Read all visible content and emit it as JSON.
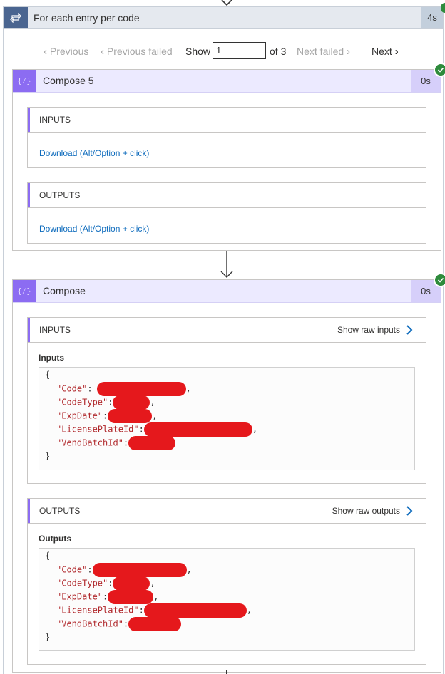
{
  "loop": {
    "title": "For each entry per code",
    "duration": "4s"
  },
  "pager": {
    "previous": "Previous",
    "previous_failed": "Previous failed",
    "show": "Show",
    "current": "1",
    "of_total": "of 3",
    "next_failed": "Next failed",
    "next": "Next"
  },
  "compose5": {
    "title": "Compose 5",
    "duration": "0s",
    "inputs_label": "INPUTS",
    "inputs_link": "Download (Alt/Option + click)",
    "outputs_label": "OUTPUTS",
    "outputs_link": "Download (Alt/Option + click)"
  },
  "compose": {
    "title": "Compose",
    "duration": "0s",
    "inputs_label": "INPUTS",
    "show_raw_inputs": "Show raw inputs",
    "inputs_sub": "Inputs",
    "outputs_label": "OUTPUTS",
    "show_raw_outputs": "Show raw outputs",
    "outputs_sub": "Outputs",
    "open_brace": "{",
    "close_brace": "}",
    "keys": [
      "\"Code\"",
      "\"CodeType\"",
      "\"ExpDate\"",
      "\"LicensePlateId\"",
      "\"VendBatchId\""
    ]
  },
  "icons": {
    "loop": "loop-icon",
    "compose": "compose-braces-icon",
    "check": "success-check-icon",
    "chevron_left": "chevron-left-icon",
    "chevron_right": "chevron-right-icon",
    "arrow_down": "arrow-down-icon"
  },
  "colors": {
    "accent": "#8c6cf2",
    "success": "#2e8b3c",
    "redaction": "#e5181c",
    "link": "#0f6cbd",
    "loop": "#4a6590"
  }
}
